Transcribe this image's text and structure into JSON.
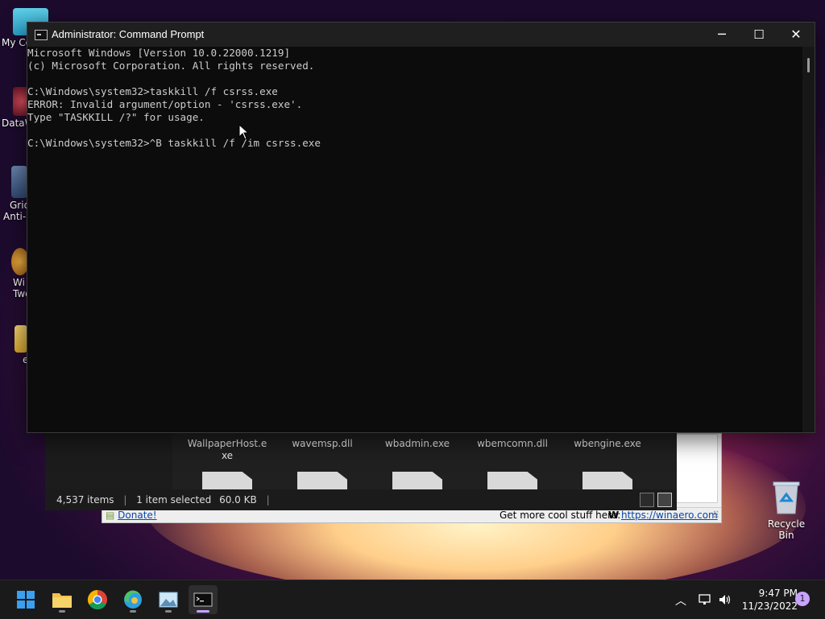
{
  "desktop": {
    "icons": [
      {
        "label": "My Co",
        "icon": "monitor-icon"
      },
      {
        "label": "DataW",
        "icon": "app-shortcut-icon"
      },
      {
        "label": "Grid",
        "label2": "Anti-M",
        "icon": "app-shortcut-icon"
      },
      {
        "label": "Wi",
        "label2": "Twe",
        "icon": "app-shortcut-icon"
      },
      {
        "label": "e",
        "icon": "folder-icon"
      }
    ],
    "recycle_bin": {
      "label": "Recycle Bin",
      "icon": "recycle-bin-icon"
    }
  },
  "cmd": {
    "title": "Administrator: Command Prompt",
    "lines": [
      "Microsoft Windows [Version 10.0.22000.1219]",
      "(c) Microsoft Corporation. All rights reserved.",
      "",
      "C:\\Windows\\system32>taskkill /f csrss.exe",
      "ERROR: Invalid argument/option - 'csrss.exe'.",
      "Type \"TASKKILL /?\" for usage.",
      "",
      "C:\\Windows\\system32>^B taskkill /f /im csrss.exe"
    ],
    "buttons": {
      "minimize": "─",
      "maximize": "☐",
      "close": "✕"
    }
  },
  "explorer": {
    "files": [
      {
        "name": "WallpaperHost.e",
        "name2": "xe"
      },
      {
        "name": "wavemsp.dll",
        "name2": ""
      },
      {
        "name": "wbadmin.exe",
        "name2": ""
      },
      {
        "name": "wbemcomn.dll",
        "name2": ""
      },
      {
        "name": "wbengine.exe",
        "name2": ""
      }
    ],
    "status": {
      "items": "4,537 items",
      "selected": "1 item selected",
      "size": "60.0 KB"
    }
  },
  "winaero": {
    "donate": "Donate!",
    "promo": "Get more cool stuff here:",
    "link": "https://winaero.com",
    "logo": "W"
  },
  "taskbar": {
    "apps": [
      {
        "name": "start",
        "icon": "windows-start-icon"
      },
      {
        "name": "file-explorer",
        "icon": "folder-icon"
      },
      {
        "name": "chrome",
        "icon": "chrome-icon"
      },
      {
        "name": "edge",
        "icon": "edge-icon"
      },
      {
        "name": "photos",
        "icon": "image-icon"
      },
      {
        "name": "terminal",
        "icon": "terminal-icon"
      }
    ],
    "time": "9:47 PM",
    "date": "11/23/2022",
    "notification_count": "1"
  }
}
